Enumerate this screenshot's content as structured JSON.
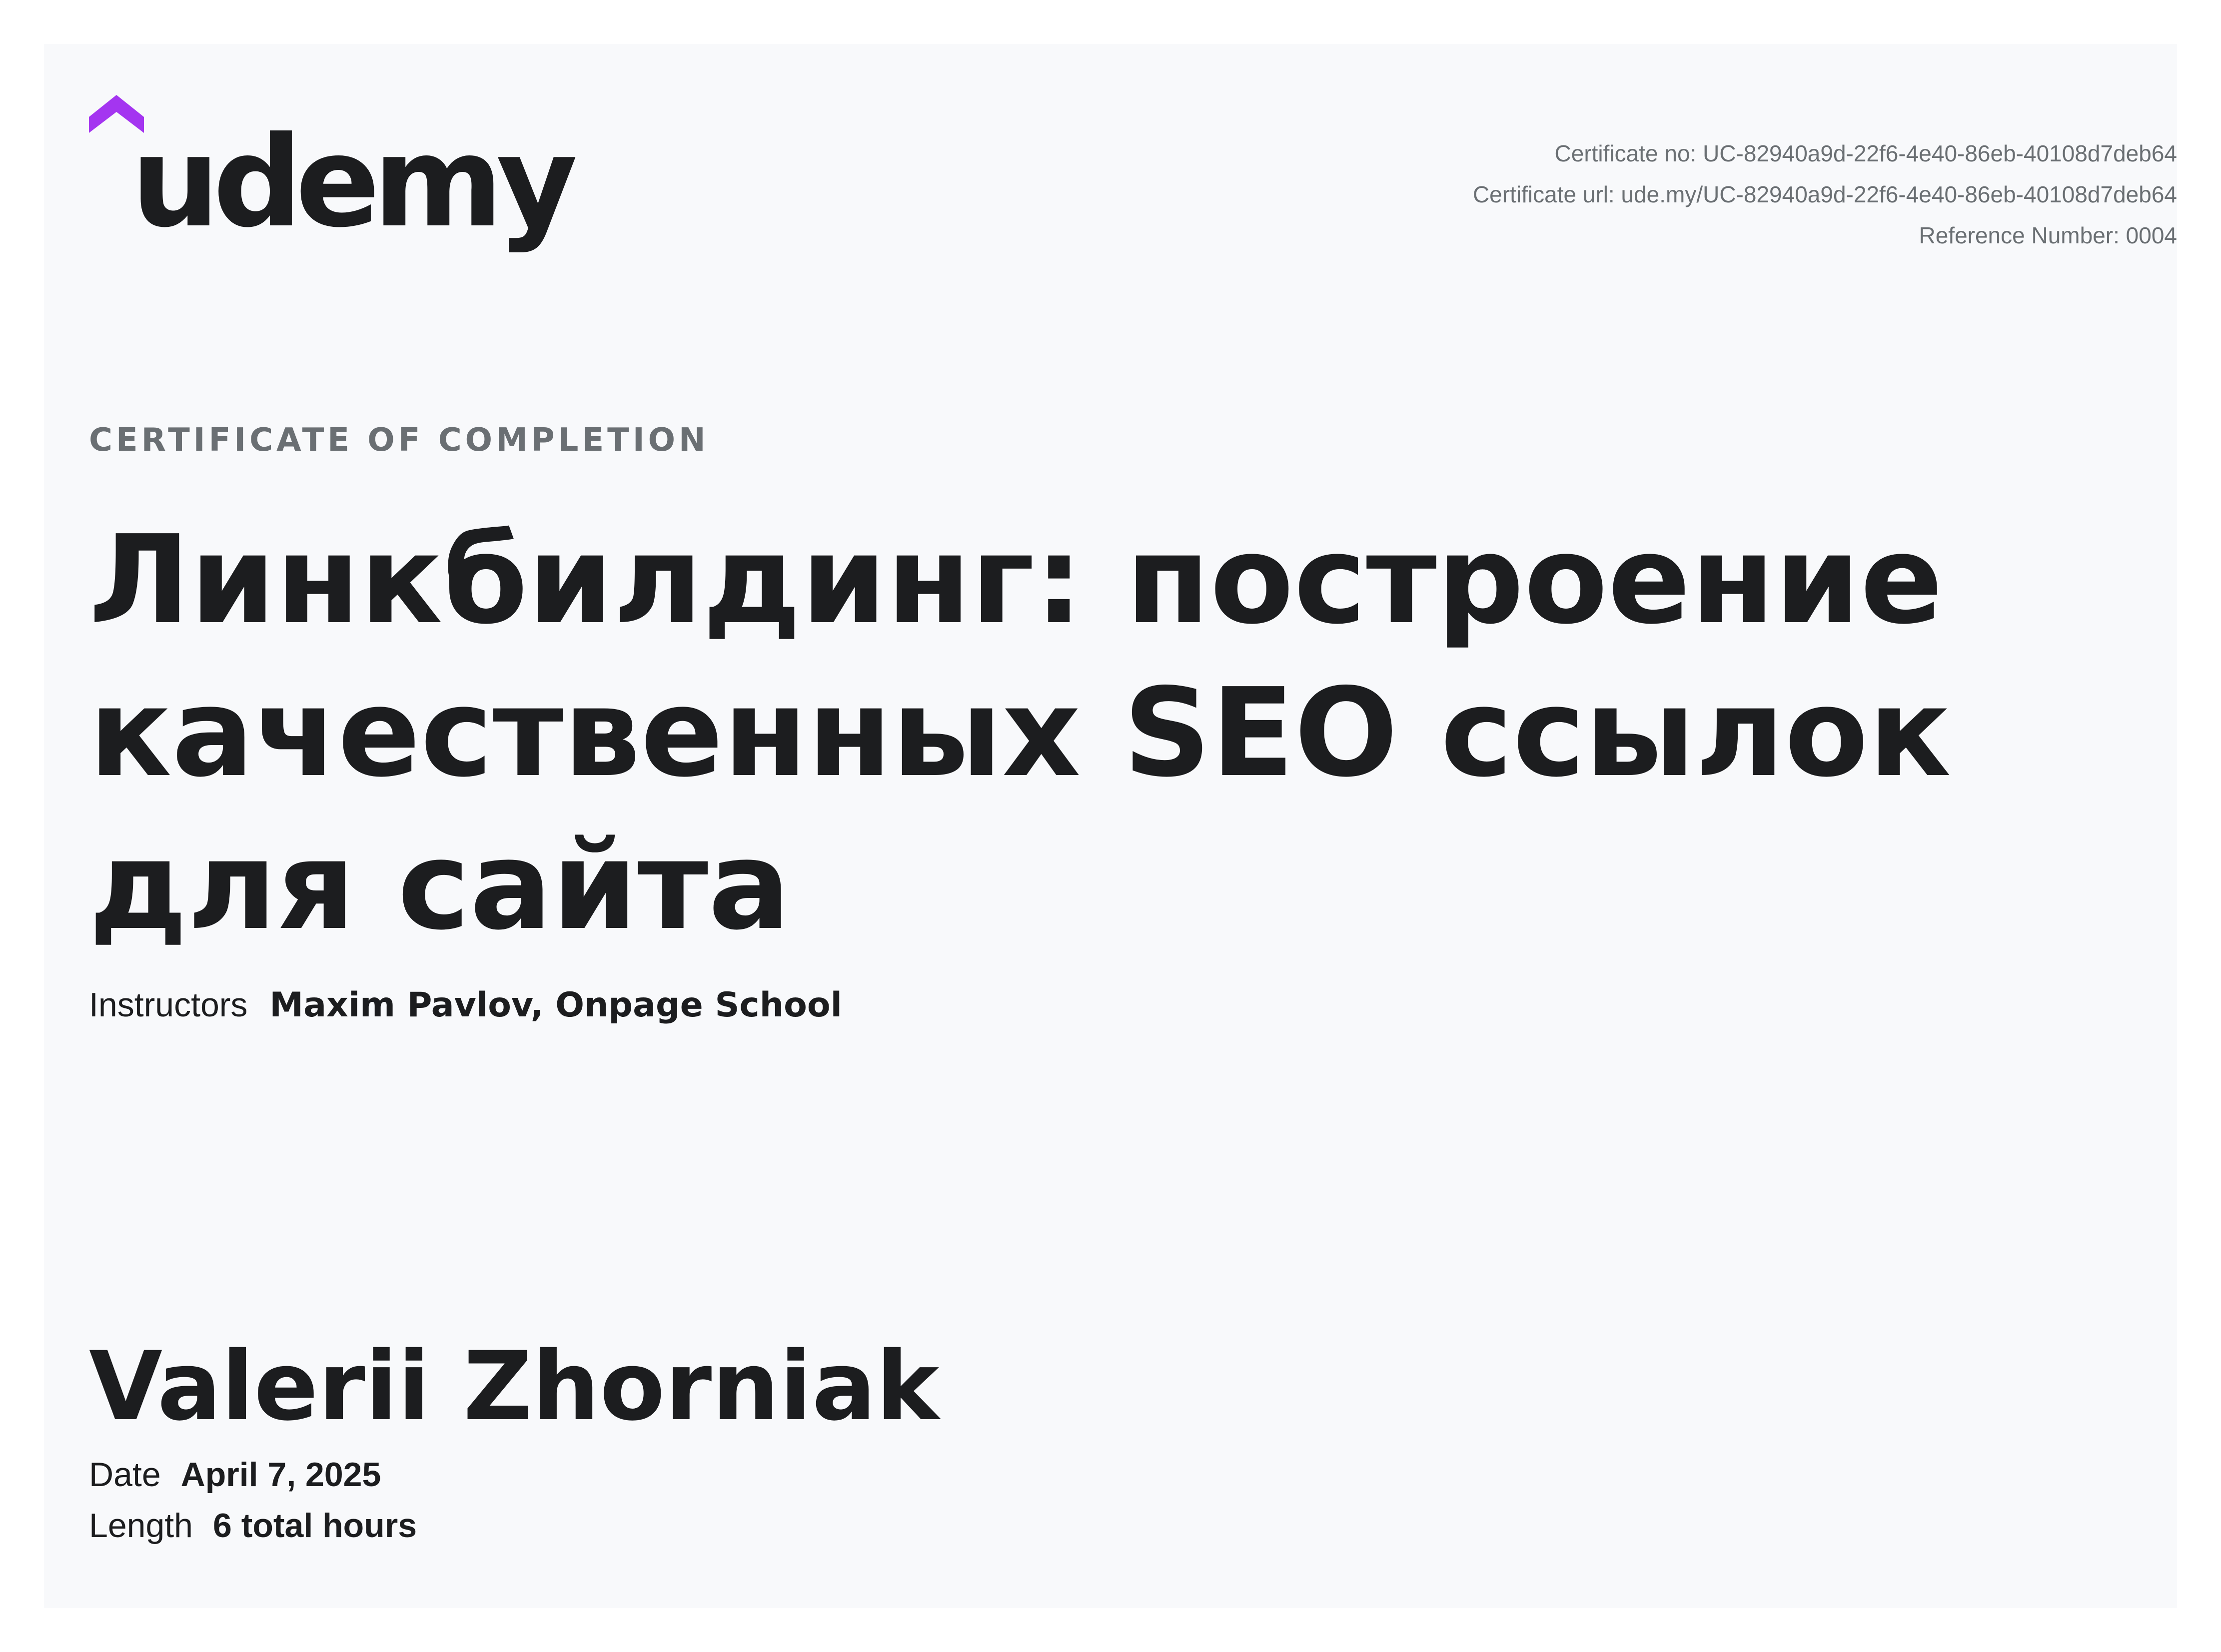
{
  "brand": {
    "logo_text": "udemy",
    "accent_color": "#a435f0",
    "text_color": "#1c1d1f"
  },
  "meta": {
    "certificate_no": "Certificate no: UC-82940a9d-22f6-4e40-86eb-40108d7deb64",
    "certificate_url": "Certificate url: ude.my/UC-82940a9d-22f6-4e40-86eb-40108d7deb64",
    "reference_number": "Reference Number: 0004"
  },
  "certificate": {
    "heading": "CERTIFICATE OF COMPLETION",
    "course_title": "Линкбилдинг: построение качественных SEO ссылок для сайта",
    "instructors_label": "Instructors",
    "instructors": "Maxim Pavlov,  Onpage School",
    "student_name": "Valerii Zhorniak",
    "date_label": "Date",
    "date_value": "April 7, 2025",
    "length_label": "Length",
    "length_value": "6 total hours"
  }
}
